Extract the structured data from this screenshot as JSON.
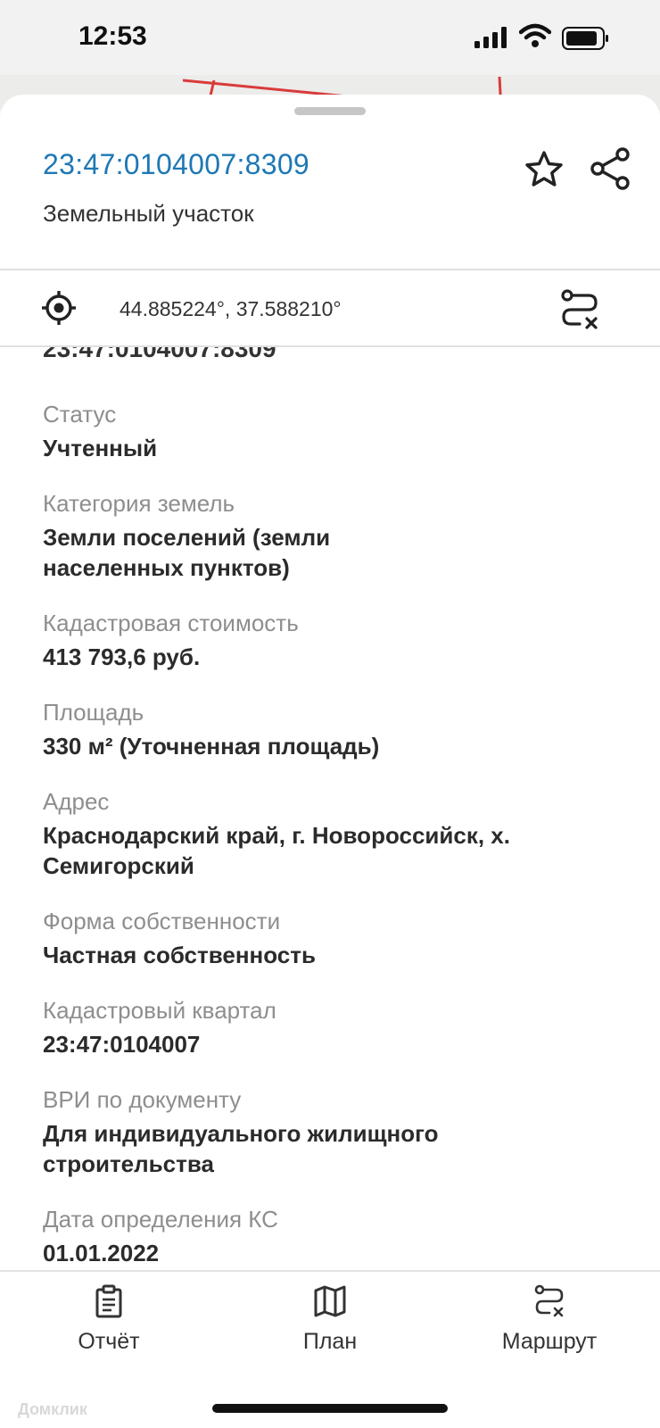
{
  "status_bar": {
    "time": "12:53"
  },
  "header": {
    "cadastral_number": "23:47:0104007:8309",
    "subtitle": "Земельный участок"
  },
  "coordinates": {
    "text": "44.885224°, 37.588210°"
  },
  "details": {
    "cut_number": "23:47:0104007:8309",
    "fields": [
      {
        "label": "Статус",
        "value": "Учтенный"
      },
      {
        "label": "Категория земель",
        "value_lines": [
          "Земли поселений (земли",
          "населенных пунктов)"
        ]
      },
      {
        "label": "Кадастровая стоимость",
        "value": "413 793,6 руб."
      },
      {
        "label": "Площадь",
        "value": "330 м² (Уточненная площадь)"
      },
      {
        "label": "Адрес",
        "value_lines": [
          "Краснодарский край, г. Новороссийск, х.",
          "Семигорский"
        ]
      },
      {
        "label": "Форма собственности",
        "value": "Частная собственность"
      },
      {
        "label": "Кадастровый квартал",
        "value": "23:47:0104007"
      },
      {
        "label": "ВРИ по документу",
        "value_lines": [
          "Для индивидуального жилищного",
          "строительства"
        ]
      },
      {
        "label": "Дата определения КС",
        "value": "01.01.2022"
      }
    ]
  },
  "tab_bar": {
    "tabs": [
      {
        "label": "Отчёт",
        "icon": "clipboard-icon"
      },
      {
        "label": "План",
        "icon": "map-icon"
      },
      {
        "label": "Маршрут",
        "icon": "route-icon"
      }
    ],
    "watermark": "Домклик"
  }
}
